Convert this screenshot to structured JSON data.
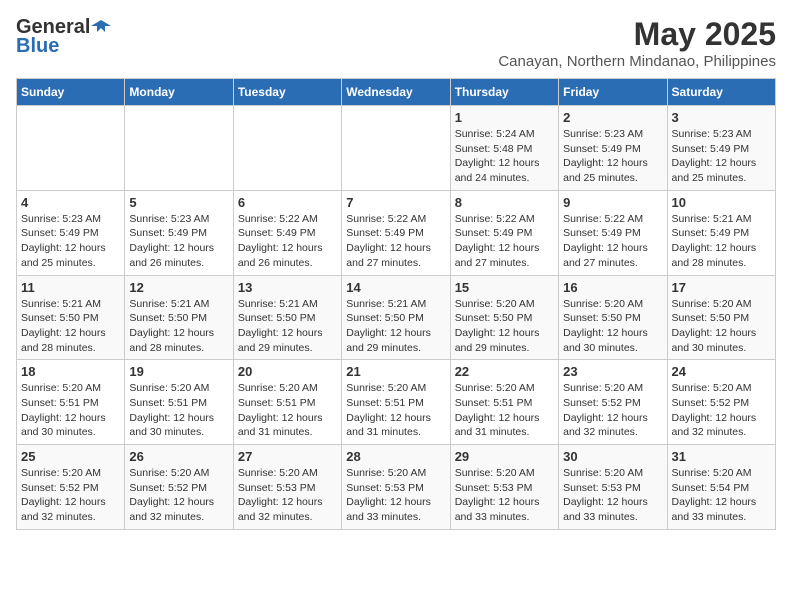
{
  "logo": {
    "general": "General",
    "blue": "Blue"
  },
  "title": "May 2025",
  "subtitle": "Canayan, Northern Mindanao, Philippines",
  "days_of_week": [
    "Sunday",
    "Monday",
    "Tuesday",
    "Wednesday",
    "Thursday",
    "Friday",
    "Saturday"
  ],
  "weeks": [
    [
      {
        "day": "",
        "info": ""
      },
      {
        "day": "",
        "info": ""
      },
      {
        "day": "",
        "info": ""
      },
      {
        "day": "",
        "info": ""
      },
      {
        "day": "1",
        "info": "Sunrise: 5:24 AM\nSunset: 5:48 PM\nDaylight: 12 hours\nand 24 minutes."
      },
      {
        "day": "2",
        "info": "Sunrise: 5:23 AM\nSunset: 5:49 PM\nDaylight: 12 hours\nand 25 minutes."
      },
      {
        "day": "3",
        "info": "Sunrise: 5:23 AM\nSunset: 5:49 PM\nDaylight: 12 hours\nand 25 minutes."
      }
    ],
    [
      {
        "day": "4",
        "info": "Sunrise: 5:23 AM\nSunset: 5:49 PM\nDaylight: 12 hours\nand 25 minutes."
      },
      {
        "day": "5",
        "info": "Sunrise: 5:23 AM\nSunset: 5:49 PM\nDaylight: 12 hours\nand 26 minutes."
      },
      {
        "day": "6",
        "info": "Sunrise: 5:22 AM\nSunset: 5:49 PM\nDaylight: 12 hours\nand 26 minutes."
      },
      {
        "day": "7",
        "info": "Sunrise: 5:22 AM\nSunset: 5:49 PM\nDaylight: 12 hours\nand 27 minutes."
      },
      {
        "day": "8",
        "info": "Sunrise: 5:22 AM\nSunset: 5:49 PM\nDaylight: 12 hours\nand 27 minutes."
      },
      {
        "day": "9",
        "info": "Sunrise: 5:22 AM\nSunset: 5:49 PM\nDaylight: 12 hours\nand 27 minutes."
      },
      {
        "day": "10",
        "info": "Sunrise: 5:21 AM\nSunset: 5:49 PM\nDaylight: 12 hours\nand 28 minutes."
      }
    ],
    [
      {
        "day": "11",
        "info": "Sunrise: 5:21 AM\nSunset: 5:50 PM\nDaylight: 12 hours\nand 28 minutes."
      },
      {
        "day": "12",
        "info": "Sunrise: 5:21 AM\nSunset: 5:50 PM\nDaylight: 12 hours\nand 28 minutes."
      },
      {
        "day": "13",
        "info": "Sunrise: 5:21 AM\nSunset: 5:50 PM\nDaylight: 12 hours\nand 29 minutes."
      },
      {
        "day": "14",
        "info": "Sunrise: 5:21 AM\nSunset: 5:50 PM\nDaylight: 12 hours\nand 29 minutes."
      },
      {
        "day": "15",
        "info": "Sunrise: 5:20 AM\nSunset: 5:50 PM\nDaylight: 12 hours\nand 29 minutes."
      },
      {
        "day": "16",
        "info": "Sunrise: 5:20 AM\nSunset: 5:50 PM\nDaylight: 12 hours\nand 30 minutes."
      },
      {
        "day": "17",
        "info": "Sunrise: 5:20 AM\nSunset: 5:50 PM\nDaylight: 12 hours\nand 30 minutes."
      }
    ],
    [
      {
        "day": "18",
        "info": "Sunrise: 5:20 AM\nSunset: 5:51 PM\nDaylight: 12 hours\nand 30 minutes."
      },
      {
        "day": "19",
        "info": "Sunrise: 5:20 AM\nSunset: 5:51 PM\nDaylight: 12 hours\nand 30 minutes."
      },
      {
        "day": "20",
        "info": "Sunrise: 5:20 AM\nSunset: 5:51 PM\nDaylight: 12 hours\nand 31 minutes."
      },
      {
        "day": "21",
        "info": "Sunrise: 5:20 AM\nSunset: 5:51 PM\nDaylight: 12 hours\nand 31 minutes."
      },
      {
        "day": "22",
        "info": "Sunrise: 5:20 AM\nSunset: 5:51 PM\nDaylight: 12 hours\nand 31 minutes."
      },
      {
        "day": "23",
        "info": "Sunrise: 5:20 AM\nSunset: 5:52 PM\nDaylight: 12 hours\nand 32 minutes."
      },
      {
        "day": "24",
        "info": "Sunrise: 5:20 AM\nSunset: 5:52 PM\nDaylight: 12 hours\nand 32 minutes."
      }
    ],
    [
      {
        "day": "25",
        "info": "Sunrise: 5:20 AM\nSunset: 5:52 PM\nDaylight: 12 hours\nand 32 minutes."
      },
      {
        "day": "26",
        "info": "Sunrise: 5:20 AM\nSunset: 5:52 PM\nDaylight: 12 hours\nand 32 minutes."
      },
      {
        "day": "27",
        "info": "Sunrise: 5:20 AM\nSunset: 5:53 PM\nDaylight: 12 hours\nand 32 minutes."
      },
      {
        "day": "28",
        "info": "Sunrise: 5:20 AM\nSunset: 5:53 PM\nDaylight: 12 hours\nand 33 minutes."
      },
      {
        "day": "29",
        "info": "Sunrise: 5:20 AM\nSunset: 5:53 PM\nDaylight: 12 hours\nand 33 minutes."
      },
      {
        "day": "30",
        "info": "Sunrise: 5:20 AM\nSunset: 5:53 PM\nDaylight: 12 hours\nand 33 minutes."
      },
      {
        "day": "31",
        "info": "Sunrise: 5:20 AM\nSunset: 5:54 PM\nDaylight: 12 hours\nand 33 minutes."
      }
    ]
  ]
}
